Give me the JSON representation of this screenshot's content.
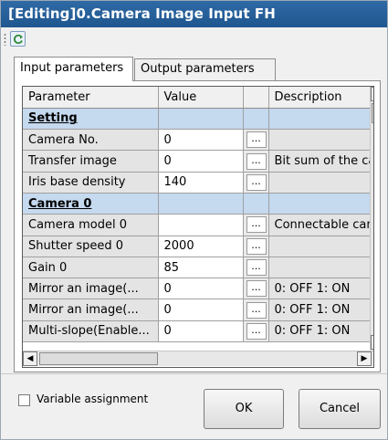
{
  "window": {
    "title": "[Editing]0.Camera Image Input FH",
    "title_bar_color": "#2a6199"
  },
  "toolbar": {
    "refresh_icon": "refresh-icon"
  },
  "tabs": [
    {
      "label": "Input parameters",
      "active": true
    },
    {
      "label": "Output parameters",
      "active": false
    }
  ],
  "grid": {
    "headers": {
      "parameter": "Parameter",
      "value": "Value",
      "description": "Description"
    },
    "rows": [
      {
        "type": "section",
        "parameter": "Setting"
      },
      {
        "type": "item",
        "parameter": "Camera No.",
        "value": "0",
        "button": "...",
        "description": ""
      },
      {
        "type": "item",
        "parameter": "Transfer image",
        "value": "0",
        "button": "...",
        "description": "Bit sum of the ca"
      },
      {
        "type": "item",
        "parameter": "Iris base density",
        "value": "140",
        "button": "...",
        "description": ""
      },
      {
        "type": "section",
        "parameter": "Camera 0"
      },
      {
        "type": "item",
        "parameter": "Camera model 0",
        "value": "",
        "button": "...",
        "description": "Connectable can"
      },
      {
        "type": "item",
        "parameter": "Shutter speed 0",
        "value": "2000",
        "button": "...",
        "description": ""
      },
      {
        "type": "item",
        "parameter": "Gain 0",
        "value": "85",
        "button": "...",
        "description": ""
      },
      {
        "type": "item",
        "parameter": "Mirror an image(...",
        "value": "0",
        "button": "...",
        "description": "0: OFF 1: ON"
      },
      {
        "type": "item",
        "parameter": "Mirror an image(...",
        "value": "0",
        "button": "...",
        "description": "0: OFF 1: ON"
      },
      {
        "type": "item",
        "parameter": "Multi-slope(Enable...",
        "value": "0",
        "button": "...",
        "description": "0: OFF 1: ON"
      }
    ],
    "section_color": "#c5d9ef"
  },
  "footer": {
    "checkbox_label": "Variable assignment",
    "checkbox_checked": false,
    "ok_label": "OK",
    "cancel_label": "Cancel"
  }
}
